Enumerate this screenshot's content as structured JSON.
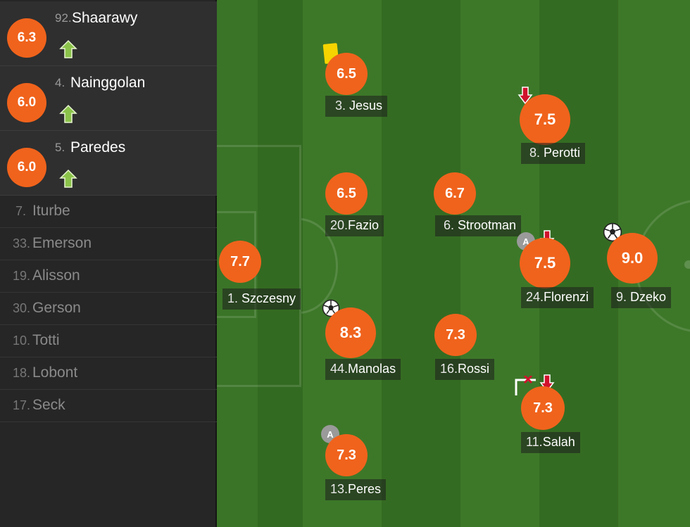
{
  "substitutes_used": [
    {
      "rating": "6.3",
      "number": "92.",
      "name": "Shaarawy"
    },
    {
      "rating": "6.0",
      "number": "4.",
      "name": "Nainggolan"
    },
    {
      "rating": "6.0",
      "number": "5.",
      "name": "Paredes"
    }
  ],
  "bench": [
    {
      "number": "7.",
      "name": "Iturbe"
    },
    {
      "number": "33.",
      "name": "Emerson"
    },
    {
      "number": "19.",
      "name": "Alisson"
    },
    {
      "number": "30.",
      "name": "Gerson"
    },
    {
      "number": "10.",
      "name": "Totti"
    },
    {
      "number": "18.",
      "name": "Lobont"
    },
    {
      "number": "17.",
      "name": "Seck"
    }
  ],
  "players": {
    "szczesny": {
      "rating": "7.7",
      "number": "1.",
      "name": "Szczesny"
    },
    "jesus": {
      "rating": "6.5",
      "number": "3.",
      "name": "Jesus"
    },
    "fazio": {
      "rating": "6.5",
      "number": "20.",
      "name": "Fazio"
    },
    "manolas": {
      "rating": "8.3",
      "number": "44.",
      "name": "Manolas"
    },
    "peres": {
      "rating": "7.3",
      "number": "13.",
      "name": "Peres"
    },
    "strootman": {
      "rating": "6.7",
      "number": "6.",
      "name": "Strootman"
    },
    "rossi": {
      "rating": "7.3",
      "number": "16.",
      "name": "Rossi"
    },
    "perotti": {
      "rating": "7.5",
      "number": "8.",
      "name": "Perotti"
    },
    "florenzi": {
      "rating": "7.5",
      "number": "24.",
      "name": "Florenzi"
    },
    "salah": {
      "rating": "7.3",
      "number": "11.",
      "name": "Salah"
    },
    "dzeko": {
      "rating": "9.0",
      "number": "9.",
      "name": "Dzeko"
    }
  },
  "badges": {
    "assist_letter": "A"
  },
  "colors": {
    "rating_orange": "#f0631c",
    "sub_in_green": "#8bc34a",
    "sub_out_red": "#d0122c",
    "pitch_light": "#3f7a2a",
    "pitch_dark": "#356a22",
    "yellow_card": "#f5d400"
  }
}
